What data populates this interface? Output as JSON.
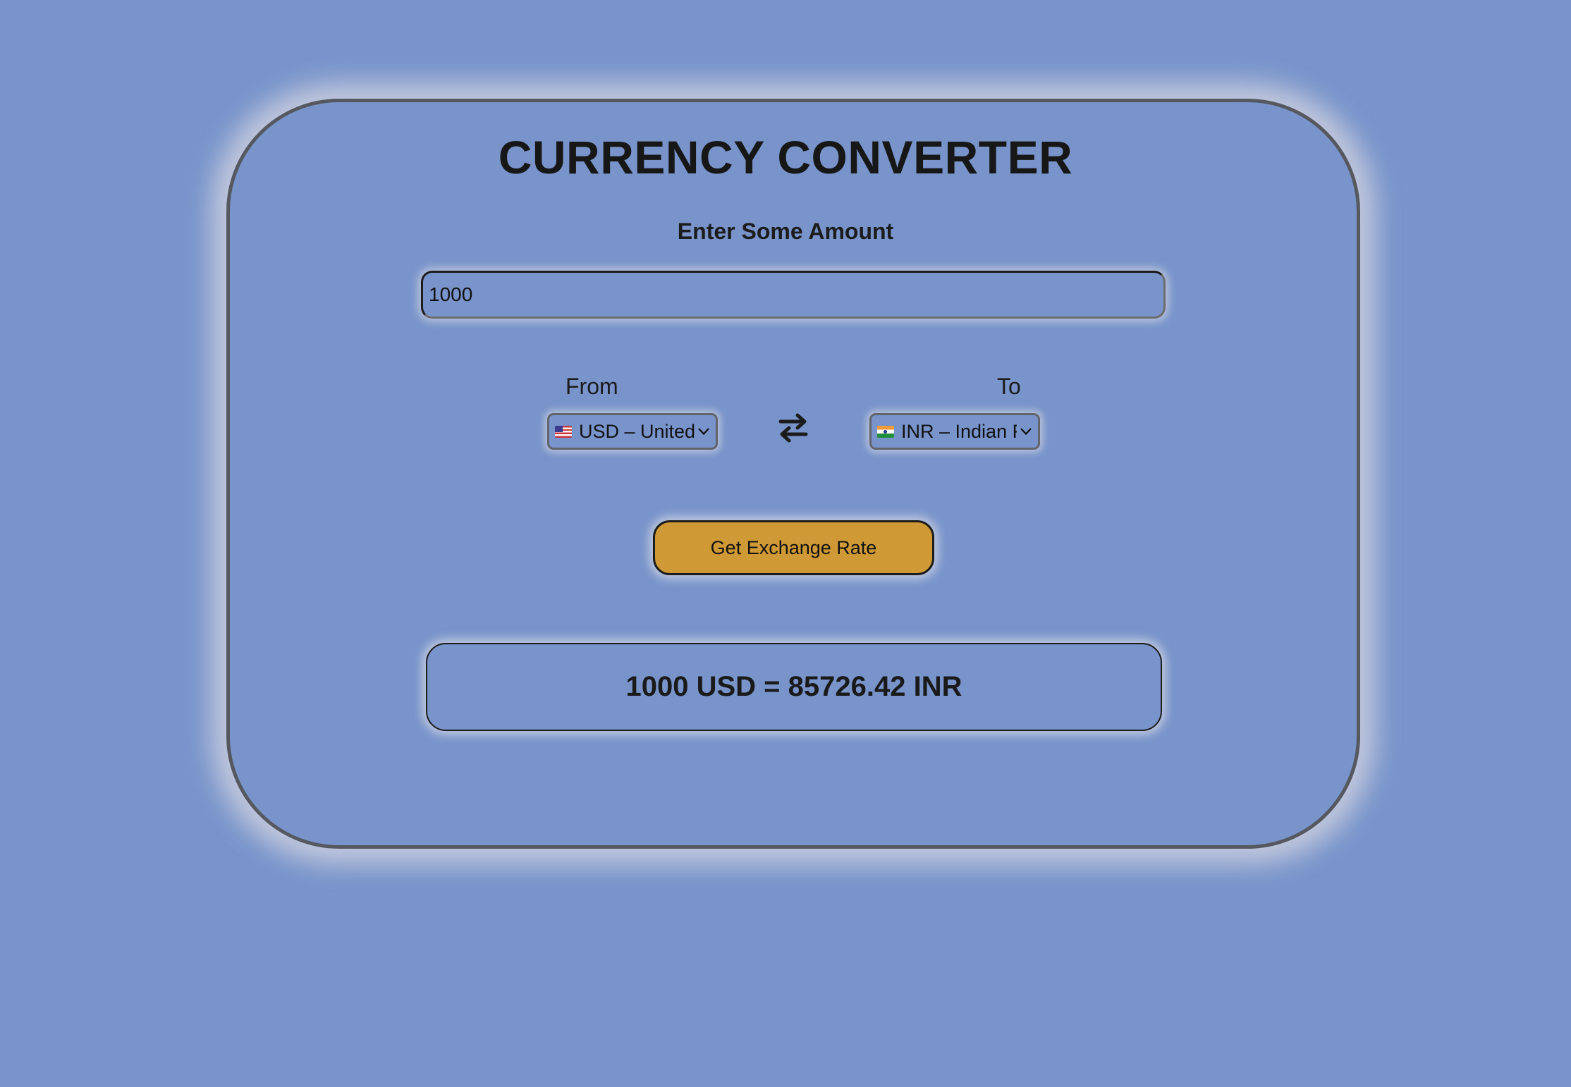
{
  "app": {
    "title": "CURRENCY CONVERTER",
    "background_color": "#7894cb",
    "accent_color": "#cf9a36"
  },
  "amount": {
    "label": "Enter Some Amount",
    "value": "1000",
    "placeholder": ""
  },
  "from": {
    "label": "From",
    "flag": "us-flag-icon",
    "selected_display": "USD – United",
    "chevron": "chevron-down-icon"
  },
  "swap": {
    "icon": "swap-arrows-icon"
  },
  "to": {
    "label": "To",
    "flag": "india-flag-icon",
    "selected_display": "INR – Indian F",
    "chevron": "chevron-down-icon"
  },
  "actions": {
    "exchange_label": "Get Exchange Rate"
  },
  "result": {
    "text": "1000 USD = 85726.42 INR"
  }
}
